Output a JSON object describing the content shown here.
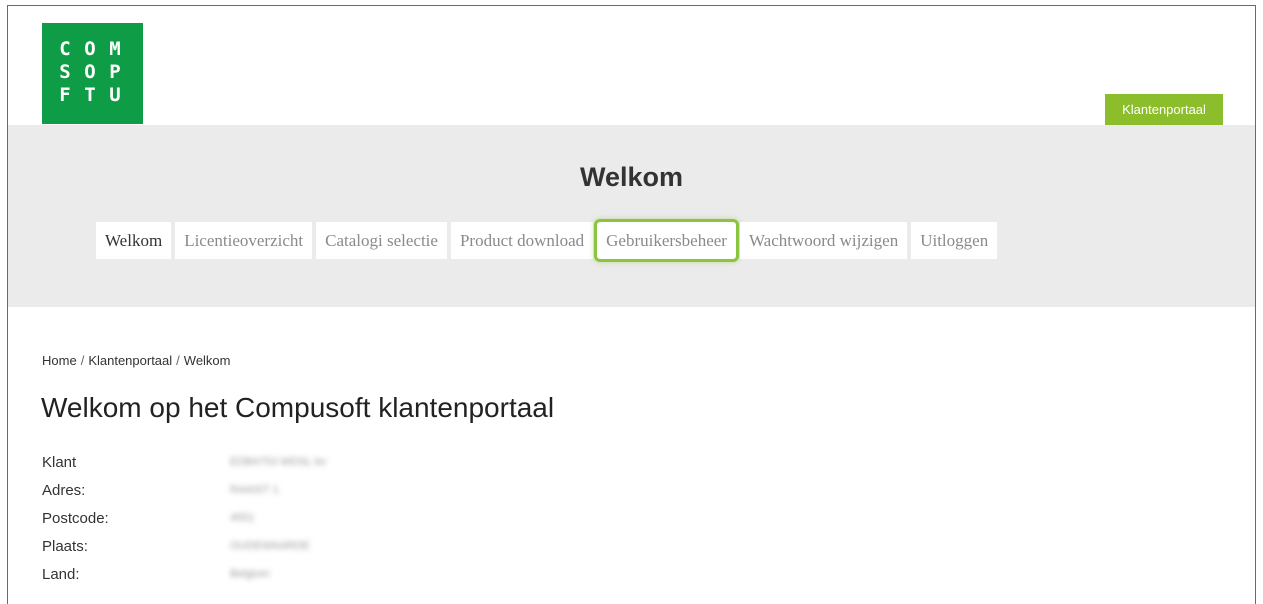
{
  "header": {
    "logo": {
      "letters": [
        "C",
        "O",
        "M",
        "S",
        "O",
        "P",
        "F",
        "T",
        "U"
      ],
      "name": "COMPUSOFT",
      "brand_color": "#0e9d46"
    },
    "portal_button": {
      "label": "Klantenportaal",
      "color": "#8bbe2a"
    }
  },
  "band": {
    "heading": "Welkom",
    "tabs": [
      {
        "label": "Welkom",
        "state": "active"
      },
      {
        "label": "Licentieoverzicht"
      },
      {
        "label": "Catalogi selectie"
      },
      {
        "label": "Product download"
      },
      {
        "label": "Gebruikersbeheer",
        "highlighted": true,
        "highlight_color": "#8bc53f"
      },
      {
        "label": "Wachtwoord wijzigen"
      },
      {
        "label": "Uitloggen"
      }
    ]
  },
  "breadcrumb": [
    "Home",
    "Klantenportaal",
    "Welkom"
  ],
  "main": {
    "title": "Welkom op het Compusoft klantenportaal",
    "fields": [
      {
        "label": "Klant",
        "value": "EDB4753 WDSL bv",
        "redacted": true
      },
      {
        "label": "Adres:",
        "value": "RAAIST 1",
        "redacted": true
      },
      {
        "label": "Postcode:",
        "value": "4551",
        "redacted": true
      },
      {
        "label": "Plaats:",
        "value": "OUDEWAARDE",
        "redacted": true
      },
      {
        "label": "Land:",
        "value": "Belgium",
        "redacted": true
      }
    ]
  }
}
